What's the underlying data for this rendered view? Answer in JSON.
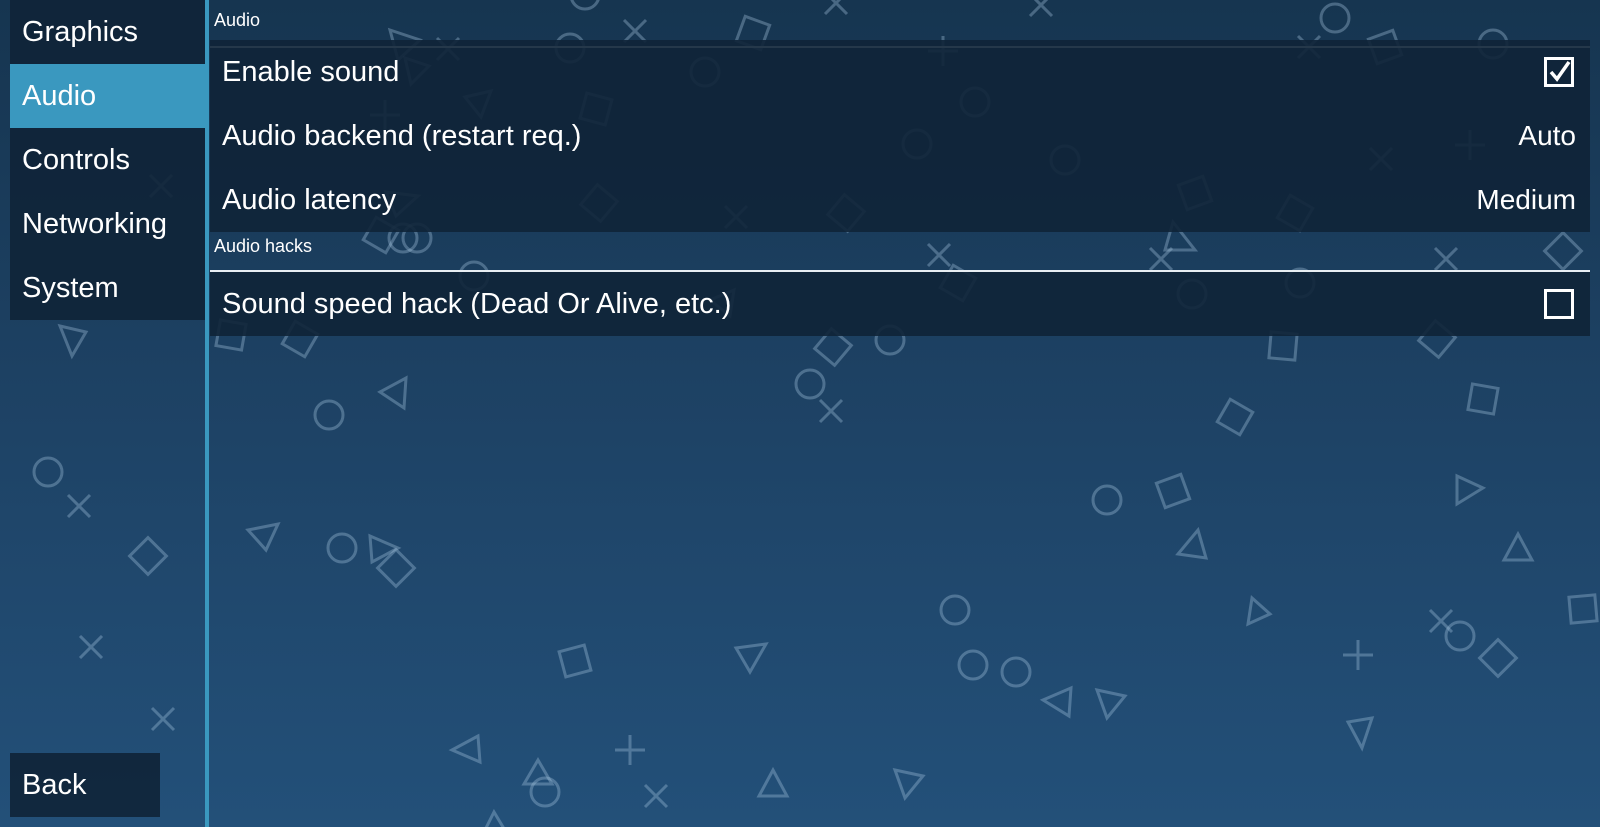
{
  "sidebar": {
    "items": [
      {
        "label": "Graphics",
        "active": false
      },
      {
        "label": "Audio",
        "active": true
      },
      {
        "label": "Controls",
        "active": false
      },
      {
        "label": "Networking",
        "active": false
      },
      {
        "label": "System",
        "active": false
      }
    ],
    "back_label": "Back"
  },
  "sections": [
    {
      "header": "Audio",
      "rows": [
        {
          "label": "Enable sound",
          "type": "checkbox",
          "checked": true
        },
        {
          "label": "Audio backend (restart req.)",
          "type": "choice",
          "value": "Auto"
        },
        {
          "label": "Audio latency",
          "type": "choice",
          "value": "Medium"
        }
      ]
    },
    {
      "header": "Audio hacks",
      "rows": [
        {
          "label": "Sound speed hack (Dead Or Alive, etc.)",
          "type": "checkbox",
          "checked": false
        }
      ]
    }
  ],
  "colors": {
    "accent": "#3a98bf",
    "panel": "#10233a",
    "background_top": "#163550",
    "background_bottom": "#235079"
  },
  "background_pattern": [
    "circle-icon",
    "cross-icon",
    "triangle-icon",
    "square-icon"
  ]
}
